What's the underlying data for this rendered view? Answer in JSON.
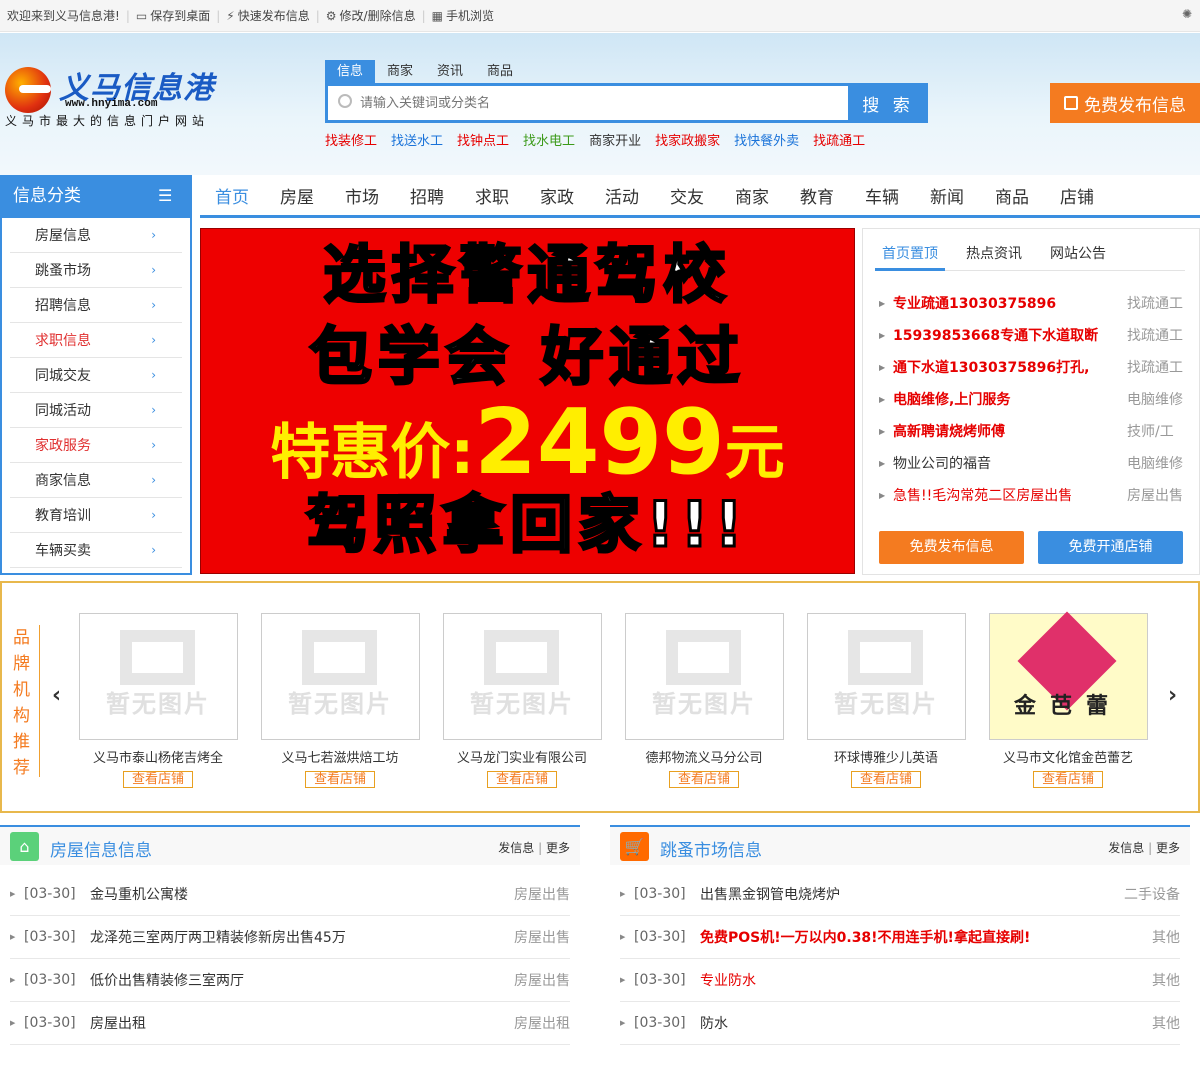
{
  "topbar": {
    "welcome": "欢迎来到义马信息港!",
    "links": [
      "保存到桌面",
      "快速发布信息",
      "修改/删除信息",
      "手机浏览"
    ]
  },
  "logo": {
    "name": "义马信息港",
    "url": "www.hnyima.com",
    "slogan": "义马市最大的信息门户网站"
  },
  "search": {
    "tabs": [
      "信息",
      "商家",
      "资讯",
      "商品"
    ],
    "placeholder": "请输入关键词或分类名",
    "button": "搜 索"
  },
  "quick_links": [
    {
      "label": "找装修工",
      "color": "#e60000"
    },
    {
      "label": "找送水工",
      "color": "#1a73d9"
    },
    {
      "label": "找钟点工",
      "color": "#e60000"
    },
    {
      "label": "找水电工",
      "color": "#3c9a1a"
    },
    {
      "label": "商家开业",
      "color": "#333333"
    },
    {
      "label": "找家政搬家",
      "color": "#e60000"
    },
    {
      "label": "找快餐外卖",
      "color": "#1a73d9"
    },
    {
      "label": "找疏通工",
      "color": "#e60000"
    }
  ],
  "publish_button": "免费发布信息",
  "sidebar": {
    "title": "信息分类",
    "items": [
      {
        "label": "房屋信息",
        "hot": false
      },
      {
        "label": "跳蚤市场",
        "hot": false
      },
      {
        "label": "招聘信息",
        "hot": false
      },
      {
        "label": "求职信息",
        "hot": true
      },
      {
        "label": "同城交友",
        "hot": false
      },
      {
        "label": "同城活动",
        "hot": false
      },
      {
        "label": "家政服务",
        "hot": true
      },
      {
        "label": "商家信息",
        "hot": false
      },
      {
        "label": "教育培训",
        "hot": false
      },
      {
        "label": "车辆买卖",
        "hot": false
      }
    ]
  },
  "nav": [
    "首页",
    "房屋",
    "市场",
    "招聘",
    "求职",
    "家政",
    "活动",
    "交友",
    "商家",
    "教育",
    "车辆",
    "新闻",
    "商品",
    "店铺"
  ],
  "banner": {
    "line1": "选择警通驾校",
    "line2": "包学会 好通过",
    "price_label": "特惠价:",
    "price": "2499",
    "unit": "元",
    "line4": "驾照拿回家!!!"
  },
  "right_panel": {
    "tabs": [
      "首页置顶",
      "热点资讯",
      "网站公告"
    ],
    "items": [
      {
        "title": "专业疏通13030375896",
        "cat": "找疏通工",
        "bold": true,
        "red": true
      },
      {
        "title": "15939853668专通下水道取断",
        "cat": "找疏通工",
        "bold": true,
        "red": true
      },
      {
        "title": "通下水道13030375896打孔,",
        "cat": "找疏通工",
        "bold": true,
        "red": true
      },
      {
        "title": "电脑维修,上门服务",
        "cat": "电脑维修",
        "bold": true,
        "red": true
      },
      {
        "title": "高新聘请烧烤师傅",
        "cat": "技师/工",
        "bold": true,
        "red": true
      },
      {
        "title": "物业公司的福音",
        "cat": "电脑维修",
        "bold": false,
        "red": false
      },
      {
        "title": "急售!!毛沟常苑二区房屋出售",
        "cat": "房屋出售",
        "bold": false,
        "red": true
      }
    ],
    "btn_publish": "免费发布信息",
    "btn_shop": "免费开通店铺"
  },
  "brand": {
    "title": "品牌机构推荐",
    "no_image": "暂无图片",
    "view_label": "查看店铺",
    "items": [
      "义马市泰山杨佬吉烤全",
      "义马七若滋烘焙工坊",
      "义马龙门实业有限公司",
      "德邦物流义马分公司",
      "环球博雅少儿英语",
      "义马市文化馆金芭蕾艺"
    ],
    "logo_text": "金芭蕾"
  },
  "sections": [
    {
      "title": "房屋信息信息",
      "post": "发信息",
      "more": "更多",
      "rows": [
        {
          "date": "[03-30]",
          "title": "金马重机公寓楼",
          "cat": "房屋出售",
          "red": false,
          "bold": false
        },
        {
          "date": "[03-30]",
          "title": "龙泽苑三室两厅两卫精装修新房出售45万",
          "cat": "房屋出售",
          "red": false,
          "bold": false
        },
        {
          "date": "[03-30]",
          "title": "低价出售精装修三室两厅",
          "cat": "房屋出售",
          "red": false,
          "bold": false
        },
        {
          "date": "[03-30]",
          "title": "房屋出租",
          "cat": "房屋出租",
          "red": false,
          "bold": false
        }
      ]
    },
    {
      "title": "跳蚤市场信息",
      "post": "发信息",
      "more": "更多",
      "rows": [
        {
          "date": "[03-30]",
          "title": "出售黑金钢管电烧烤炉",
          "cat": "二手设备",
          "red": false,
          "bold": false
        },
        {
          "date": "[03-30]",
          "title": "免费POS机!一万以内0.38!不用连手机!拿起直接刷!",
          "cat": "其他",
          "red": true,
          "bold": true
        },
        {
          "date": "[03-30]",
          "title": "专业防水",
          "cat": "其他",
          "red": true,
          "bold": false
        },
        {
          "date": "[03-30]",
          "title": "防水",
          "cat": "其他",
          "red": false,
          "bold": false
        }
      ]
    }
  ],
  "colors": {
    "primary": "#3a8ee0",
    "orange": "#f47b20",
    "red": "#e60000",
    "gold": "#e8b84c"
  }
}
